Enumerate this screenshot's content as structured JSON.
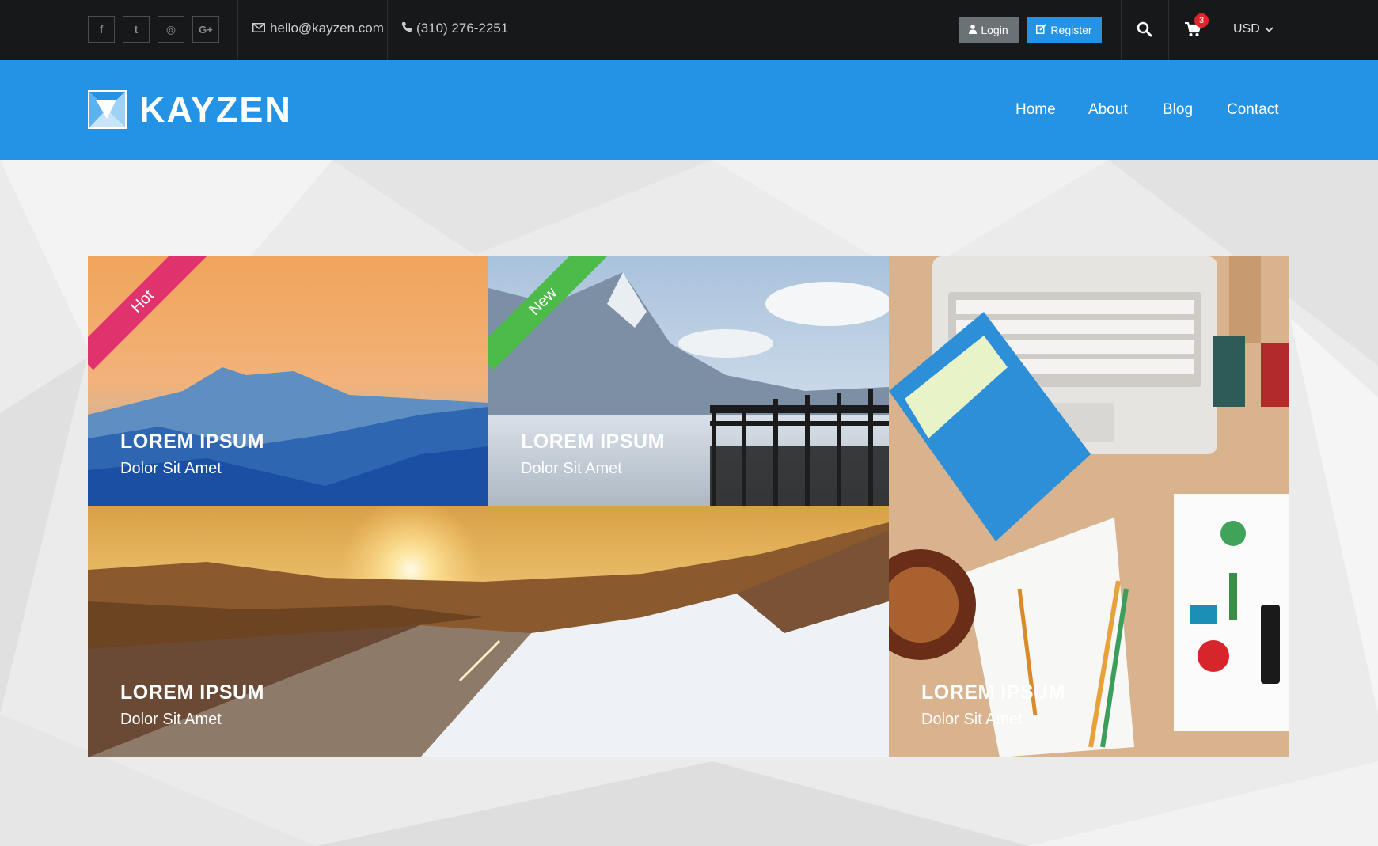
{
  "topbar": {
    "social": [
      {
        "name": "facebook-icon",
        "glyph": "f"
      },
      {
        "name": "twitter-icon",
        "glyph": "t"
      },
      {
        "name": "dribbble-icon",
        "glyph": "◎"
      },
      {
        "name": "google-plus-icon",
        "glyph": "G+"
      }
    ],
    "email": "hello@kayzen.com",
    "phone": "(310) 276-2251",
    "login_label": "Login",
    "register_label": "Register",
    "cart_count": "3",
    "currency": "USD"
  },
  "nav": {
    "brand": "KAYZEN",
    "links": [
      "Home",
      "About",
      "Blog",
      "Contact"
    ]
  },
  "hero": {
    "tiles": [
      {
        "title": "LOREM IPSUM",
        "subtitle": "Dolor Sit Amet",
        "ribbon": "Hot"
      },
      {
        "title": "LOREM IPSUM",
        "subtitle": "Dolor Sit Amet",
        "ribbon": "New"
      },
      {
        "title": "LOREM IPSUM",
        "subtitle": "Dolor Sit Amet"
      },
      {
        "title": "LOREM IPSUM",
        "subtitle": "Dolor Sit Amet"
      }
    ]
  },
  "colors": {
    "topbar": "#161819",
    "brand_blue": "#2493e6",
    "login_gray": "#6b7276",
    "ribbon_hot": "#e0336e",
    "ribbon_new": "#4cbb4a",
    "badge_red": "#e0262d"
  }
}
